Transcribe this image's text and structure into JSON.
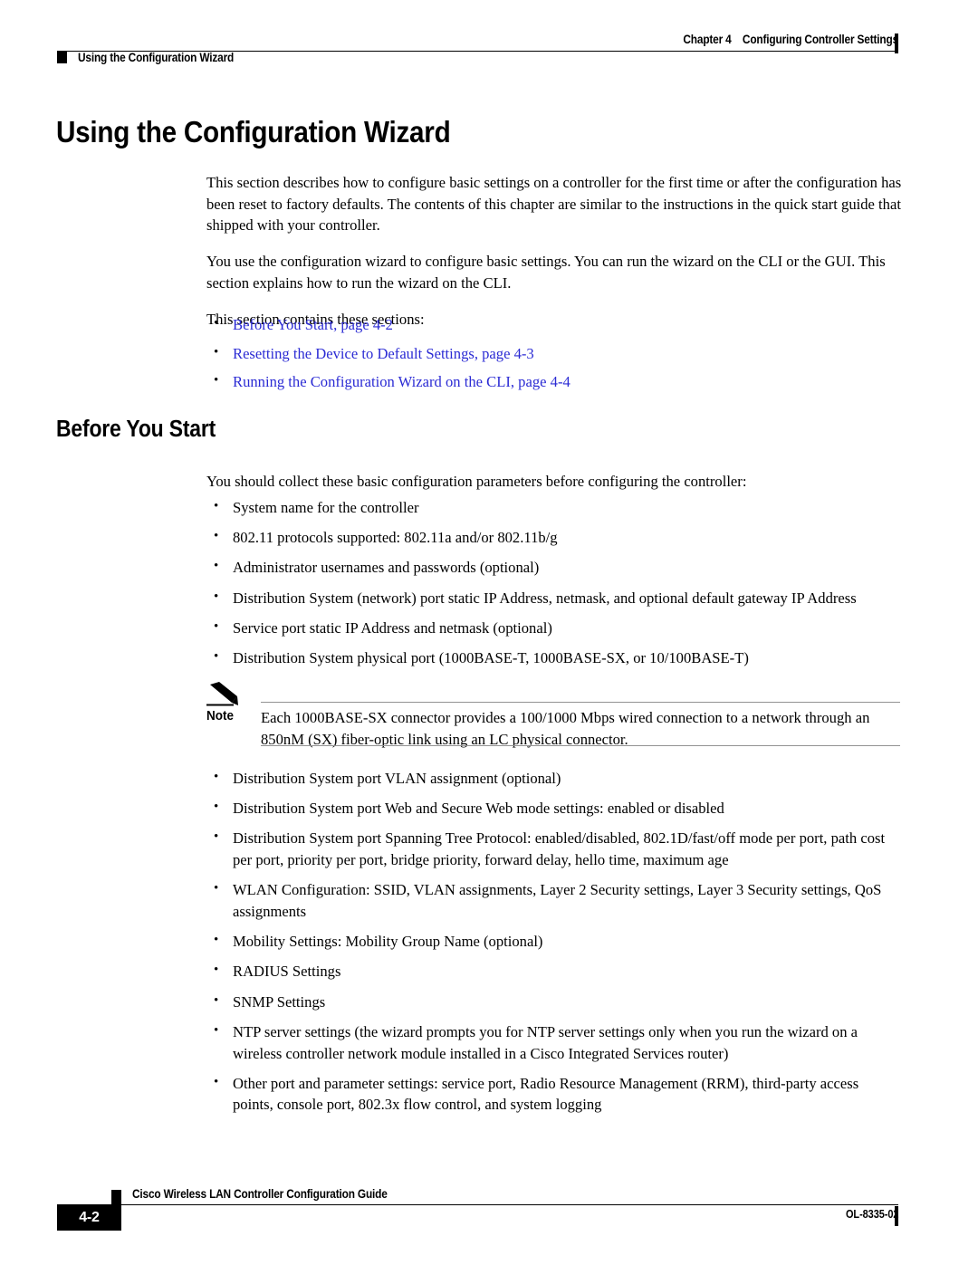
{
  "header": {
    "chapter_number": "Chapter 4",
    "chapter_title": "Configuring Controller Settings",
    "running_section": "Using the Configuration Wizard"
  },
  "main": {
    "h1": "Using the Configuration Wizard",
    "intro_paragraph_1": "This section describes how to configure basic settings on a controller for the first time or after the configuration has been reset to factory defaults. The contents of this chapter are similar to the instructions in the quick start guide that shipped with your controller.",
    "intro_paragraph_2": "You use the configuration wizard to configure basic settings. You can run the wizard on the CLI or the GUI. This section explains how to run the wizard on the CLI.",
    "intro_paragraph_3": "This section contains these sections:",
    "section_links": [
      "Before You Start, page 4-2",
      "Resetting the Device to Default Settings, page 4-3",
      "Running the Configuration Wizard on the CLI, page 4-4"
    ],
    "link_color": "#2B2BD4",
    "h2": "Before You Start",
    "before_you_start_lead": "You should collect these basic configuration parameters before configuring the controller:",
    "params_list_part1": [
      "System name for the controller",
      "802.11 protocols supported: 802.11a and/or 802.11b/g",
      "Administrator usernames and passwords (optional)",
      "Distribution System (network) port static IP Address, netmask, and optional default gateway IP Address",
      "Service port static IP Address and netmask (optional)",
      "Distribution System physical port (1000BASE-T, 1000BASE-SX, or 10/100BASE-T)"
    ],
    "note": {
      "label": "Note",
      "text": "Each 1000BASE-SX connector provides a 100/1000 Mbps wired connection to a network through an 850nM (SX) fiber-optic link using an LC physical connector."
    },
    "params_list_part2": [
      "Distribution System port VLAN assignment (optional)",
      "Distribution System port Web and Secure Web mode settings: enabled or disabled",
      "Distribution System port Spanning Tree Protocol: enabled/disabled, 802.1D/fast/off mode per port, path cost per port, priority per port, bridge priority, forward delay, hello time, maximum age",
      "WLAN Configuration: SSID, VLAN assignments, Layer 2 Security settings, Layer 3 Security settings, QoS assignments",
      "Mobility Settings: Mobility Group Name (optional)",
      "RADIUS Settings",
      "SNMP Settings",
      "NTP server settings (the wizard prompts you for NTP server settings only when you run the wizard on a wireless controller network module installed in a Cisco Integrated Services router)",
      "Other port and parameter settings: service port, Radio Resource Management (RRM), third-party access points, console port, 802.3x flow control, and system logging"
    ]
  },
  "footer": {
    "page_number": "4-2",
    "guide_title": "Cisco Wireless LAN Controller Configuration Guide",
    "doc_id": "OL-8335-02"
  }
}
